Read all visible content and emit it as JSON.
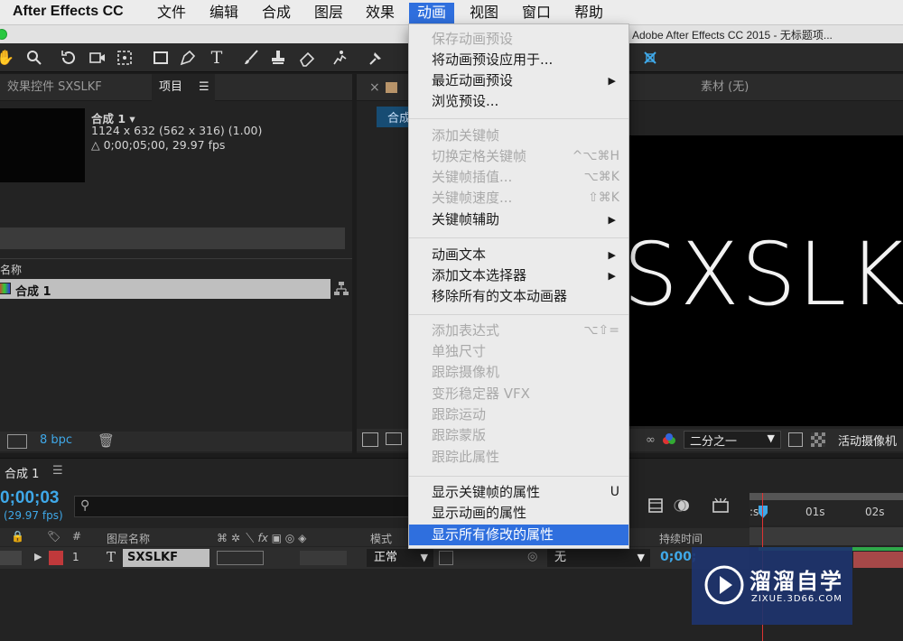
{
  "menubar": {
    "app": "After Effects CC",
    "items": [
      "文件",
      "编辑",
      "合成",
      "图层",
      "效果",
      "动画",
      "视图",
      "窗口",
      "帮助"
    ],
    "active_index": 5
  },
  "window": {
    "title": "Adobe After Effects CC 2015 - 无标题项..."
  },
  "project_panel": {
    "tab_effects": "效果控件 SXSLKF",
    "tab_project": "项目",
    "comp_name": "合成 1 ▾",
    "comp_size": "1124 x 632  (562 x 316) (1.00)",
    "comp_duration": "△ 0;00;05;00, 29.97 fps",
    "col_name": "名称",
    "row_name": "合成 1",
    "bpc": "8 bpc"
  },
  "viewer": {
    "tab_close": "×",
    "tab_comp": "合成",
    "tab_footage": "素材  (无)",
    "comp_text": "SXSLKF",
    "zoom": "二分之一",
    "camera": "活动摄像机"
  },
  "timeline": {
    "tab": "合成 1",
    "timecode": "0;00;03",
    "fps": "(29.97 fps)",
    "col_layer_name": "图层名称",
    "col_mode": "模式",
    "col_duration": "持续时间",
    "layer_index": "1",
    "layer_name": "SXSLKF",
    "layer_mode": "正常",
    "layer_parent": "无",
    "layer_time": "0;00;",
    "ruler_labels": [
      ":s",
      "01s",
      "02s"
    ]
  },
  "menu": {
    "items": [
      {
        "label": "保存动画预设",
        "disabled": true,
        "shortcut": "",
        "submenu": false
      },
      {
        "label": "将动画预设应用于...",
        "disabled": false,
        "shortcut": "",
        "submenu": false
      },
      {
        "label": "最近动画预设",
        "disabled": false,
        "shortcut": "",
        "submenu": true
      },
      {
        "label": "浏览预设...",
        "disabled": false,
        "shortcut": "",
        "submenu": false
      },
      {
        "label": "添加关键帧",
        "disabled": true,
        "shortcut": "",
        "submenu": false
      },
      {
        "label": "切换定格关键帧",
        "disabled": true,
        "shortcut": "^⌥⌘H",
        "submenu": false
      },
      {
        "label": "关键帧插值...",
        "disabled": true,
        "shortcut": "⌥⌘K",
        "submenu": false
      },
      {
        "label": "关键帧速度...",
        "disabled": true,
        "shortcut": "⇧⌘K",
        "submenu": false
      },
      {
        "label": "关键帧辅助",
        "disabled": false,
        "shortcut": "",
        "submenu": true
      },
      {
        "label": "动画文本",
        "disabled": false,
        "shortcut": "",
        "submenu": true
      },
      {
        "label": "添加文本选择器",
        "disabled": false,
        "shortcut": "",
        "submenu": true
      },
      {
        "label": "移除所有的文本动画器",
        "disabled": false,
        "shortcut": "",
        "submenu": false
      },
      {
        "label": "添加表达式",
        "disabled": true,
        "shortcut": "⌥⇧=",
        "submenu": false
      },
      {
        "label": "单独尺寸",
        "disabled": true,
        "shortcut": "",
        "submenu": false
      },
      {
        "label": "跟踪摄像机",
        "disabled": true,
        "shortcut": "",
        "submenu": false
      },
      {
        "label": "变形稳定器 VFX",
        "disabled": true,
        "shortcut": "",
        "submenu": false
      },
      {
        "label": "跟踪运动",
        "disabled": true,
        "shortcut": "",
        "submenu": false
      },
      {
        "label": "跟踪蒙版",
        "disabled": true,
        "shortcut": "",
        "submenu": false
      },
      {
        "label": "跟踪此属性",
        "disabled": true,
        "shortcut": "",
        "submenu": false
      },
      {
        "label": "显示关键帧的属性",
        "disabled": false,
        "shortcut": "U",
        "submenu": false
      },
      {
        "label": "显示动画的属性",
        "disabled": false,
        "shortcut": "",
        "submenu": false
      },
      {
        "label": "显示所有修改的属性",
        "disabled": false,
        "shortcut": "",
        "submenu": false,
        "highlighted": true
      }
    ]
  },
  "watermark": {
    "brand_cn": "溜溜自学",
    "brand_en": "ZIXUE.3D66.COM"
  },
  "colors": {
    "accent": "#2f6fde",
    "timecode": "#3fa8e8",
    "label_red": "#c0393b"
  }
}
